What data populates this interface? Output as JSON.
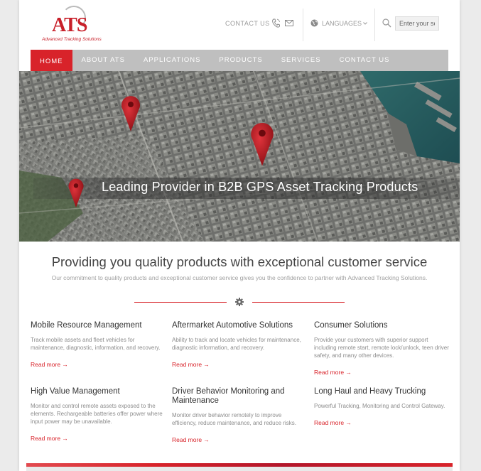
{
  "header": {
    "logo_text": "ATS",
    "logo_tagline": "Advanced Tracking Solutions",
    "contact_label": "CONTACT US",
    "languages_label": "LANGUAGES",
    "search_placeholder": "Enter your search"
  },
  "nav": {
    "items": [
      {
        "label": "HOME",
        "active": true
      },
      {
        "label": "ABOUT ATS",
        "active": false
      },
      {
        "label": "APPLICATIONS",
        "active": false
      },
      {
        "label": "PRODUCTS",
        "active": false
      },
      {
        "label": "SERVICES",
        "active": false
      },
      {
        "label": "CONTACT US",
        "active": false
      }
    ]
  },
  "hero": {
    "caption": "Leading Provider in B2B GPS Asset Tracking Products"
  },
  "intro": {
    "title": "Providing you quality products with exceptional customer service",
    "subtitle": "Our commitment to quality products and exceptional customer service gives you the confidence to partner with Advanced Tracking Solutions."
  },
  "features": [
    {
      "title": "Mobile Resource Management",
      "desc": "Track mobile assets and fleet vehicles for maintenance, diagnostic, information, and recovery.",
      "link": "Read more →"
    },
    {
      "title": "Aftermarket Automotive Solutions",
      "desc": "Ability to track and locate vehicles for maintenance, diagnostic information, and recovery.",
      "link": "Read more →"
    },
    {
      "title": "Consumer Solutions",
      "desc": "Provide your customers with superior support including remote start, remote lock/unlock, teen driver safety, and many other devices.",
      "link": "Read more →"
    },
    {
      "title": "High Value Management",
      "desc": "Monitor and control remote assets exposed to the elements. Rechargeable batteries offer power where input power may be unavailable.",
      "link": "Read more →"
    },
    {
      "title": "Driver Behavior Monitoring and Maintenance",
      "desc": "Monitor driver behavior remotely to improve efficiency, reduce maintenance, and reduce risks.",
      "link": "Read more →"
    },
    {
      "title": "Long Haul and Heavy Trucking",
      "desc": "Powerful Tracking, Monitoring and Control Gateway.",
      "link": "Read more →"
    }
  ],
  "colors": {
    "accent": "#d8232a",
    "nav_bg": "#bfbfbf",
    "page_bg": "#ebebeb"
  },
  "icons": [
    "phone-icon",
    "mail-icon",
    "globe-icon",
    "chevron-down-icon",
    "search-icon",
    "gear-icon",
    "map-pin-icon"
  ]
}
